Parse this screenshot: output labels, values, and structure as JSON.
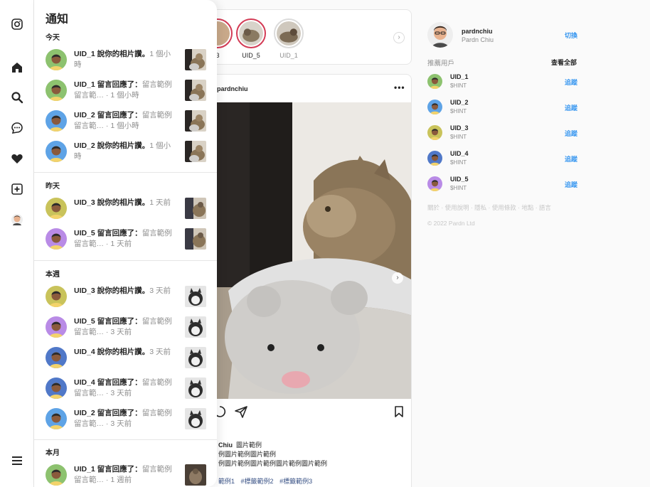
{
  "rail": {
    "icons": [
      "instagram-icon",
      "home-icon",
      "search-icon",
      "messages-icon",
      "heart-icon",
      "new-post-icon",
      "profile-avatar",
      "menu-icon"
    ]
  },
  "notifications": {
    "title": "通知",
    "sections": [
      {
        "label": "今天",
        "items": [
          {
            "user": "UID_1",
            "action": "說你的相片讚。",
            "text": "",
            "time": "1 個小時",
            "avatar_bg": "#8dc26f",
            "thumb": "cat1"
          },
          {
            "user": "UID_1",
            "action": "留言回應了：",
            "text": "留言範例留言範…",
            "time": "1 個小時",
            "avatar_bg": "#8dc26f",
            "thumb": "cat1"
          },
          {
            "user": "UID_2",
            "action": "留言回應了：",
            "text": "留言範例留言範…",
            "time": "1 個小時",
            "avatar_bg": "#5ea3e6",
            "thumb": "cat1"
          },
          {
            "user": "UID_2",
            "action": "說你的相片讚。",
            "text": "",
            "time": "1 個小時",
            "avatar_bg": "#5ea3e6",
            "thumb": "cat1"
          }
        ]
      },
      {
        "label": "昨天",
        "items": [
          {
            "user": "UID_3",
            "action": "說你的相片讚。",
            "text": "",
            "time": "1 天前",
            "avatar_bg": "#c9c35b",
            "thumb": "cat2"
          },
          {
            "user": "UID_5",
            "action": "留言回應了：",
            "text": "留言範例留言範…",
            "time": "1 天前",
            "avatar_bg": "#b98be6",
            "thumb": "cat2"
          }
        ]
      },
      {
        "label": "本週",
        "items": [
          {
            "user": "UID_3",
            "action": "說你的相片讚。",
            "text": "",
            "time": "3 天前",
            "avatar_bg": "#c9c35b",
            "thumb": "cat3"
          },
          {
            "user": "UID_5",
            "action": "留言回應了：",
            "text": "留言範例留言範…",
            "time": "3 天前",
            "avatar_bg": "#b98be6",
            "thumb": "cat3"
          },
          {
            "user": "UID_4",
            "action": "說你的相片讚。",
            "text": "",
            "time": "3 天前",
            "avatar_bg": "#5078c8",
            "thumb": "cat3"
          },
          {
            "user": "UID_4",
            "action": "留言回應了：",
            "text": "留言範例留言範…",
            "time": "3 天前",
            "avatar_bg": "#5078c8",
            "thumb": "cat3"
          },
          {
            "user": "UID_2",
            "action": "留言回應了：",
            "text": "留言範例留言範…",
            "time": "3 天前",
            "avatar_bg": "#5ea3e6",
            "thumb": "cat3"
          }
        ]
      },
      {
        "label": "本月",
        "items": [
          {
            "user": "UID_1",
            "action": "留言回應了：",
            "text": "留言範例留言範…",
            "time": "1 週前",
            "avatar_bg": "#8dc26f",
            "thumb": "cat4"
          }
        ]
      }
    ]
  },
  "stories": {
    "items": [
      {
        "label": "3",
        "seen": false
      },
      {
        "label": "UID_5",
        "seen": false
      },
      {
        "label": "UID_1",
        "seen": true
      }
    ],
    "next": "›"
  },
  "post": {
    "user": "pardnchiu",
    "more": "•••",
    "next": "›",
    "caption_user": "Chiu",
    "caption_title": "圖片範例",
    "caption_line1": "例圖片範例圖片範例",
    "caption_line2": "例圖片範例圖片範例圖片範例圖片範例",
    "tags": [
      "範例1",
      "#標籤範例2",
      "#標籤範例3"
    ]
  },
  "me": {
    "username": "pardnchiu",
    "name": "Pardn Chiu",
    "switch": "切換"
  },
  "suggestions": {
    "title": "推薦用戶",
    "see_all": "查看全部",
    "follow": "追蹤",
    "items": [
      {
        "name": "UID_1",
        "hint": "$HINT",
        "avatar_bg": "#8dc26f"
      },
      {
        "name": "UID_2",
        "hint": "$HINT",
        "avatar_bg": "#5ea3e6"
      },
      {
        "name": "UID_3",
        "hint": "$HINT",
        "avatar_bg": "#c9c35b"
      },
      {
        "name": "UID_4",
        "hint": "$HINT",
        "avatar_bg": "#5078c8"
      },
      {
        "name": "UID_5",
        "hint": "$HINT",
        "avatar_bg": "#b98be6"
      }
    ]
  },
  "footer": {
    "links": [
      "關於",
      "使用說明",
      "隱私",
      "使用條款",
      "地點",
      "語言"
    ],
    "copyright": "© 2022 Pardn Ltd"
  },
  "colors": {
    "link": "#3897f0",
    "story_ring": "#d33b55",
    "text": "#262626",
    "muted": "#8e8e8e"
  }
}
